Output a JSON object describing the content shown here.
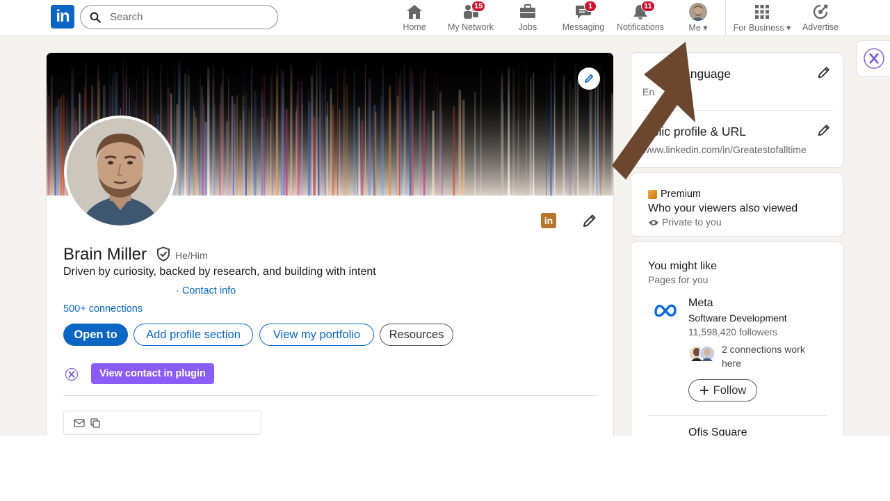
{
  "nav": {
    "search_placeholder": "Search",
    "items": [
      {
        "label": "Home",
        "icon": "home-icon"
      },
      {
        "label": "My Network",
        "icon": "network-icon",
        "badge": "15"
      },
      {
        "label": "Jobs",
        "icon": "briefcase-icon"
      },
      {
        "label": "Messaging",
        "icon": "messaging-icon",
        "badge": "1"
      },
      {
        "label": "Notifications",
        "icon": "bell-icon",
        "badge": "11"
      },
      {
        "label": "Me",
        "icon": "avatar"
      },
      {
        "label": "For Business",
        "icon": "grid-icon"
      },
      {
        "label": "Advertise",
        "icon": "advertise-icon"
      }
    ]
  },
  "profile": {
    "name": "Brain Miller",
    "pronouns": "He/Him",
    "headline": "Driven by curiosity, backed by research, and building with intent",
    "contact_info": "· Contact info",
    "connections": "500+ connections",
    "buttons": {
      "open_to": "Open to",
      "add_section": "Add profile section",
      "portfolio": "View my portfolio",
      "resources": "Resources"
    },
    "plugin_button": "View contact in plugin"
  },
  "right": {
    "language": {
      "title": "Profile language",
      "title_visible": "anguage",
      "value_visible": "En"
    },
    "public_url": {
      "title_visible": "ublic profile & URL",
      "url_visible": "www.linkedin.com/in/Greatestofalltime"
    },
    "premium": {
      "label": "Premium",
      "title": "Who your viewers also viewed",
      "privacy": "Private to you"
    },
    "suggest": {
      "title": "You might like",
      "subtitle": "Pages for you",
      "page_name": "Meta",
      "page_category": "Software Development",
      "followers": "11,598,420 followers",
      "connections_line1": "2 connections work",
      "connections_line2": "here",
      "follow": "Follow",
      "next_page": "Ofis Square"
    }
  },
  "colors": {
    "linkedin_blue": "#0a66c2",
    "badge_red": "#cb112d",
    "plugin_purple": "#8b5cf6",
    "arrow_brown": "#6b4730"
  }
}
